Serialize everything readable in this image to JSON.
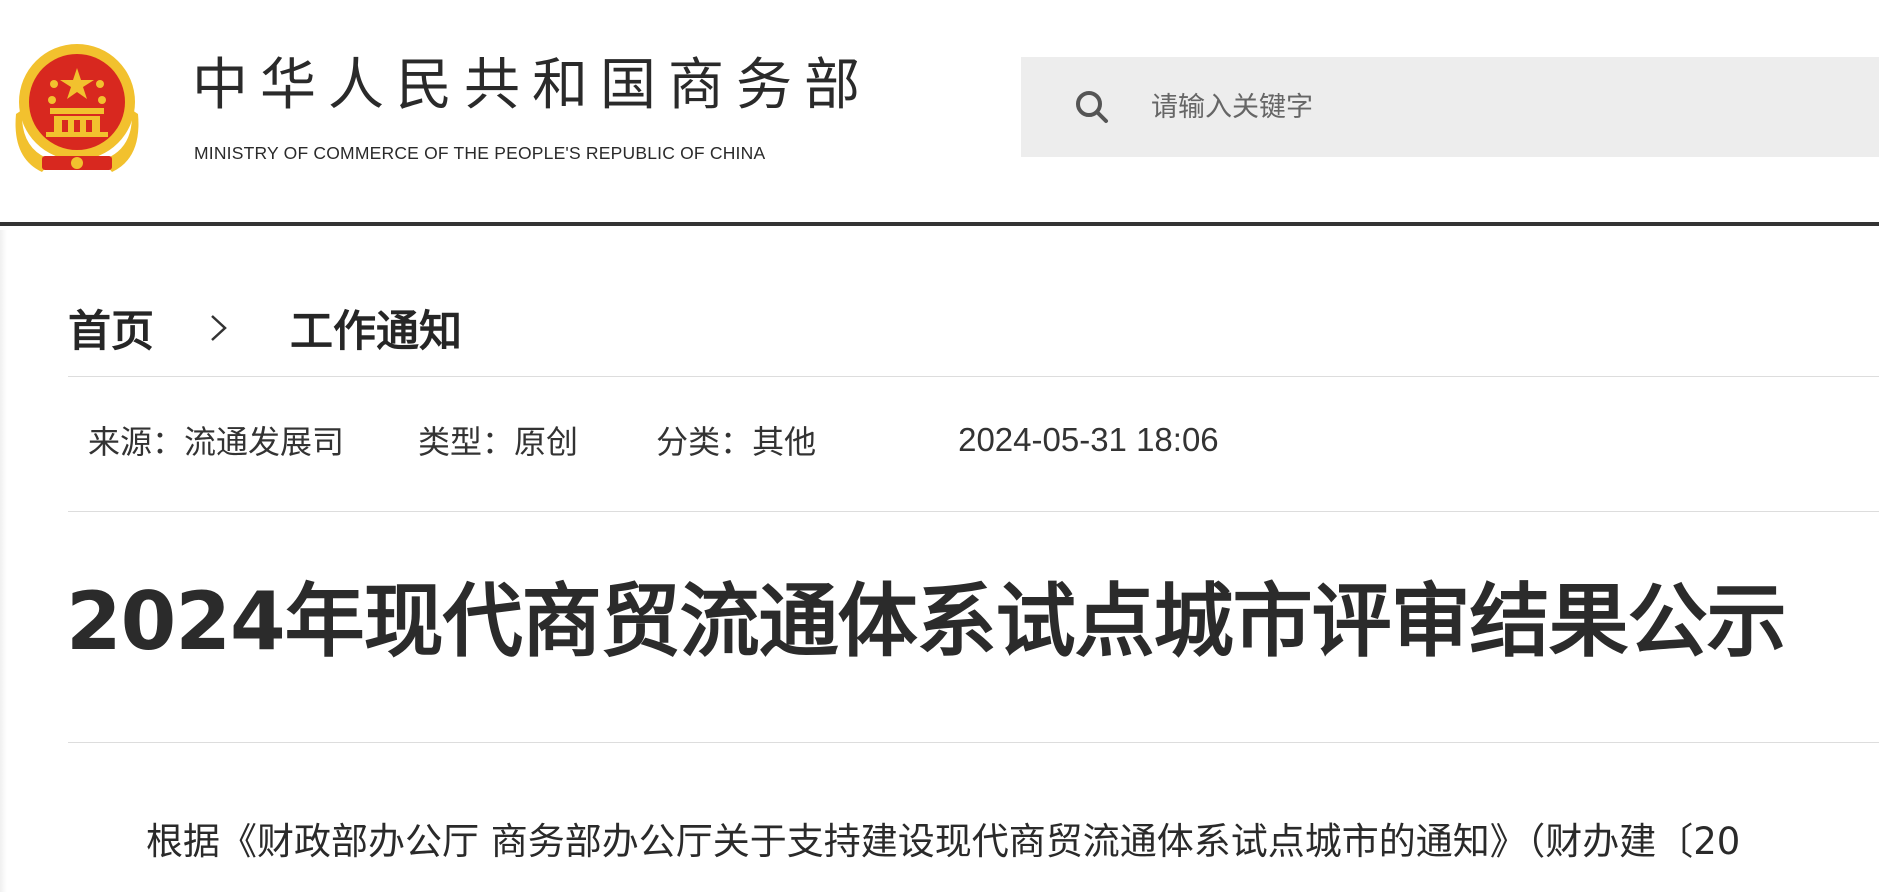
{
  "header": {
    "brand_cn": "中华人民共和国商务部",
    "brand_en": "MINISTRY OF COMMERCE OF THE PEOPLE'S REPUBLIC OF CHINA",
    "emblem_icon": "national-emblem-icon",
    "search": {
      "placeholder": "请输入关键字",
      "value": "",
      "icon": "search-icon"
    }
  },
  "breadcrumb": {
    "home": "首页",
    "separator_icon": "chevron-right-icon",
    "current": "工作通知"
  },
  "meta": {
    "source_label": "来源：",
    "source_value": "流通发展司",
    "type_label": "类型：",
    "type_value": "原创",
    "category_label": "分类：",
    "category_value": "其他",
    "date": "2024-05-31 18:06"
  },
  "article": {
    "title": "2024年现代商贸流通体系试点城市评审结果公示",
    "body_first_line": "根据《财政部办公厅 商务部办公厅关于支持建设现代商贸流通体系试点城市的通知》（财办建〔20"
  },
  "colors": {
    "emblem_red": "#d8281f",
    "emblem_gold": "#f2c12e",
    "header_rule": "#333333",
    "search_bg": "#ededed",
    "text": "#222222"
  }
}
